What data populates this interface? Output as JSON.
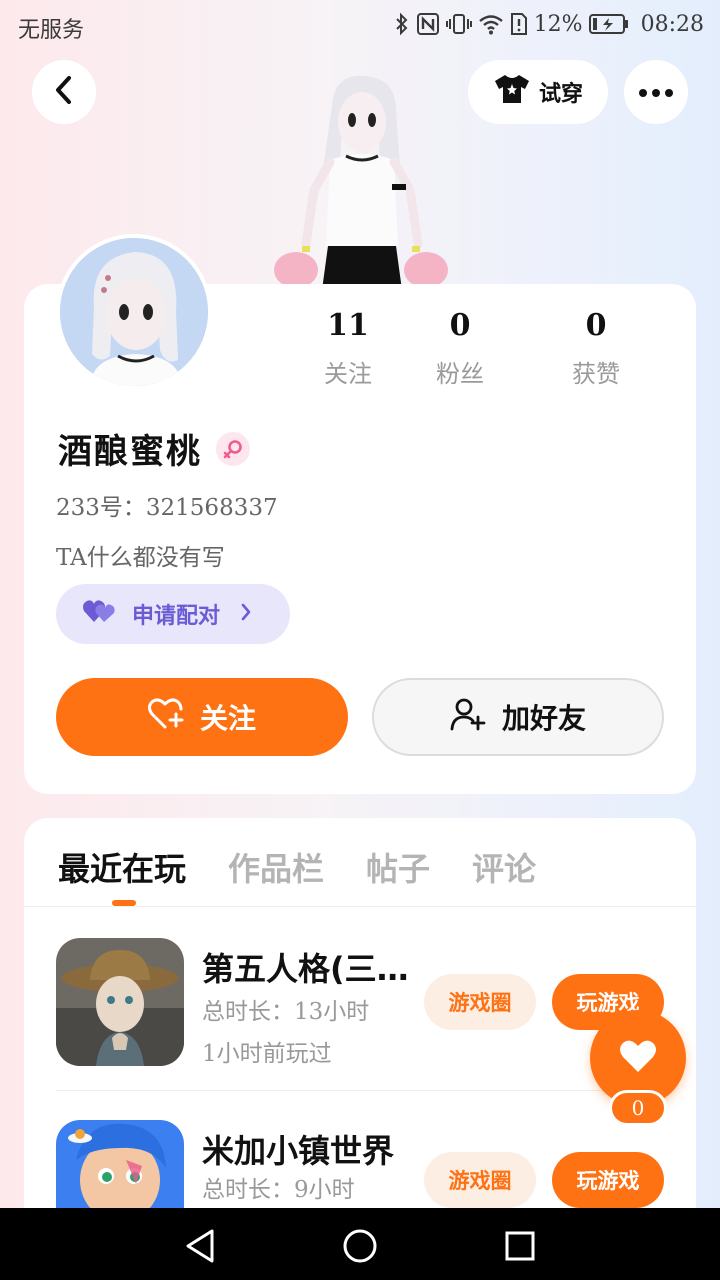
{
  "status_bar": {
    "carrier": "无服务",
    "battery": "12%",
    "time": "08:28"
  },
  "header": {
    "try_on_label": "试穿"
  },
  "profile": {
    "stats": [
      {
        "value": "11",
        "label": "关注"
      },
      {
        "value": "0",
        "label": "粉丝"
      },
      {
        "value": "0",
        "label": "获赞"
      }
    ],
    "nickname": "酒酿蜜桃",
    "gender": "female",
    "uid_label": "233号：321568337",
    "bio": "TA什么都没有写",
    "pair_label": "申请配对",
    "follow_label": "关注",
    "add_friend_label": "加好友"
  },
  "tabs": [
    {
      "label": "最近在玩",
      "active": true
    },
    {
      "label": "作品栏",
      "active": false
    },
    {
      "label": "帖子",
      "active": false
    },
    {
      "label": "评论",
      "active": false
    }
  ],
  "games": [
    {
      "title": "第五人格(三…",
      "duration": "总时长：13小时",
      "last_played": "1小时前玩过",
      "circle_label": "游戏圈",
      "play_label": "玩游戏"
    },
    {
      "title": "米加小镇世界",
      "duration": "总时长：9小时",
      "circle_label": "游戏圈",
      "play_label": "玩游戏"
    }
  ],
  "like": {
    "count": "0"
  },
  "colors": {
    "accent": "#ff7214",
    "pair_purple": "#6b5cd6"
  }
}
